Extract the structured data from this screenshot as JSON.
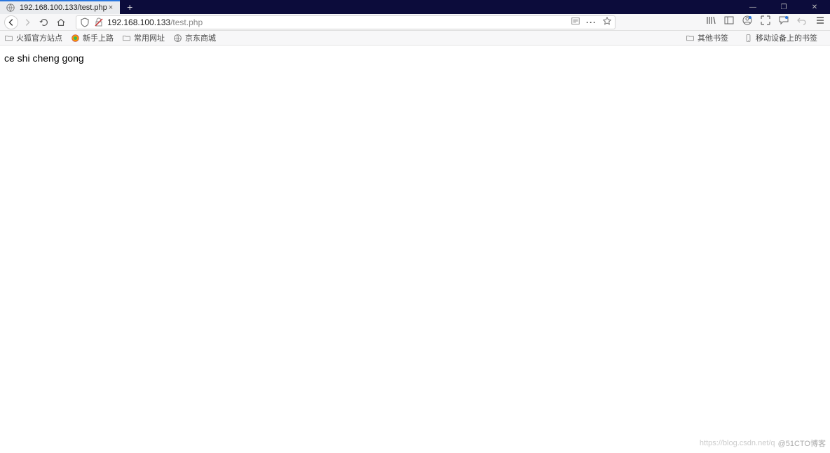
{
  "titlebar": {
    "tab_title": "192.168.100.133/test.php",
    "close_glyph": "×",
    "newtab_glyph": "+",
    "minimize_glyph": "—",
    "maximize_glyph": "❐",
    "close_window_glyph": "✕"
  },
  "url": {
    "host": "192.168.100.133",
    "path": "/test.php",
    "ellipsis": "···"
  },
  "bookmarks": {
    "b1": "火狐官方站点",
    "b2": "新手上路",
    "b3": "常用网址",
    "b4": "京东商城",
    "r1": "其他书签",
    "r2": "移动设备上的书签"
  },
  "page": {
    "text": "ce shi cheng gong"
  },
  "watermark": {
    "a": "https://blog.csdn.net/q",
    "b": "@51CTO博客"
  }
}
